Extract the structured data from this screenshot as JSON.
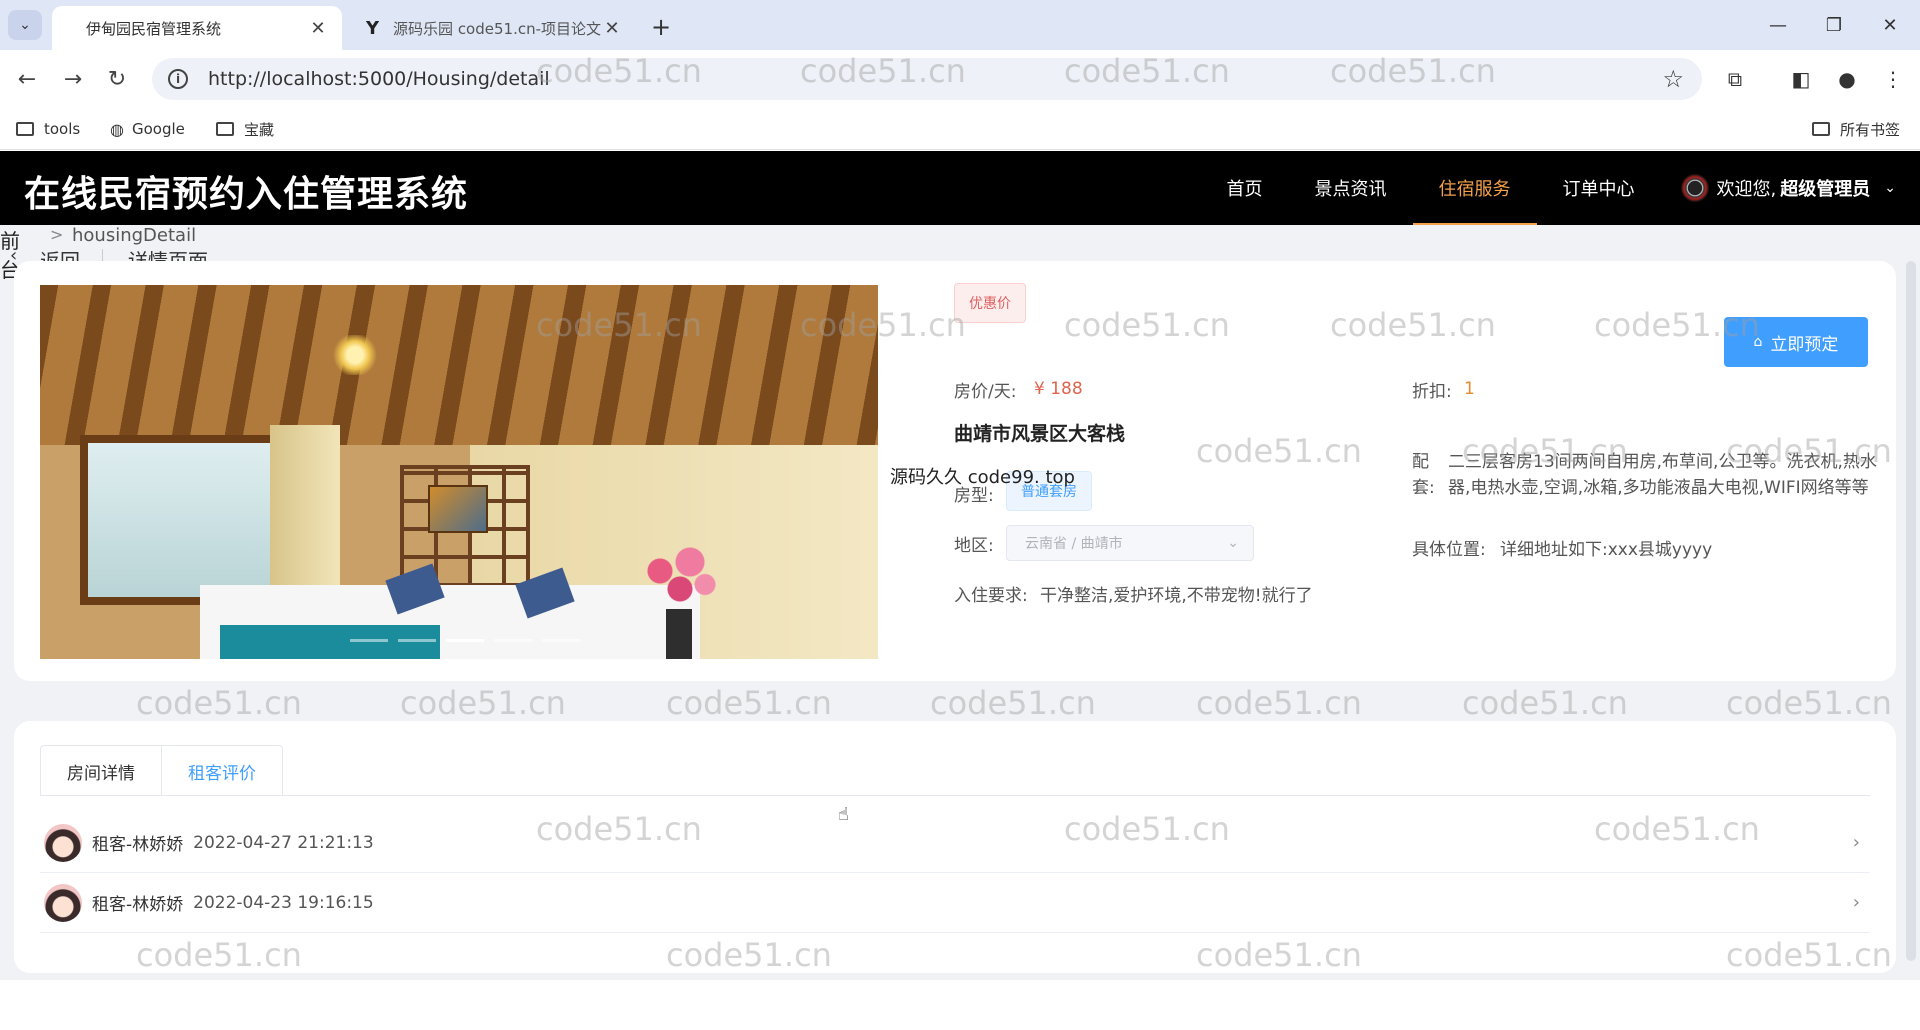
{
  "browser": {
    "tabs": [
      {
        "title": "伊甸园民宿管理系统",
        "close": "✕"
      },
      {
        "title": "源码乐园 code51.cn-项目论文",
        "close": "✕"
      }
    ],
    "new_tab": "+",
    "url": "http://localhost:5000/Housing/detail",
    "bookmarks": [
      "tools",
      "Google",
      "宝藏"
    ],
    "all_bookmarks": "所有书签"
  },
  "site": {
    "title": "在线民宿预约入住管理系统",
    "nav": [
      "首页",
      "景点资讯",
      "住宿服务",
      "订单中心"
    ],
    "active_nav": "住宿服务",
    "welcome": "欢迎您,",
    "username": "超级管理员"
  },
  "breadcrumb": {
    "front": "前台",
    "separator": ">",
    "current": "housingDetail"
  },
  "page_header": {
    "back": "返回",
    "title": "详情页面"
  },
  "detail": {
    "discount_tag": "优惠价",
    "book_button": "立即预定",
    "price_label": "房价/天:",
    "price_value": "¥ 188",
    "discount_label": "折扣:",
    "discount_value": "1",
    "hotel_name": "曲靖市风景区大客栈",
    "room_type_label": "房型:",
    "room_type_value": "普通套房",
    "overlay_text": "源码久久 code99. top",
    "amenities_label": "配套:",
    "amenities_value": "二三层客房13间两间自用房,布草间,公卫等。洗衣机,热水器,电热水壶,空调,冰箱,多功能液晶大电视,WIFI网络等等",
    "region_label": "地区:",
    "region_value": "云南省 / 曲靖市",
    "location_label": "具体位置:",
    "location_value": "详细地址如下:xxx县城yyyy",
    "requirement_label": "入住要求:",
    "requirement_value": "干净整洁,爱护环境,不带宠物!就行了"
  },
  "tabs": [
    "房间详情",
    "租客评价"
  ],
  "active_tab": "租客评价",
  "reviews": [
    {
      "user": "租客-林娇娇",
      "time": "2022-04-27 21:21:13"
    },
    {
      "user": "租客-林娇娇",
      "time": "2022-04-23 19:16:15"
    }
  ],
  "watermark": "code51.cn",
  "colors": {
    "accent": "#409eff",
    "nav_active": "#f5a04a",
    "price": "#e0644e",
    "header_bg": "#000000"
  }
}
